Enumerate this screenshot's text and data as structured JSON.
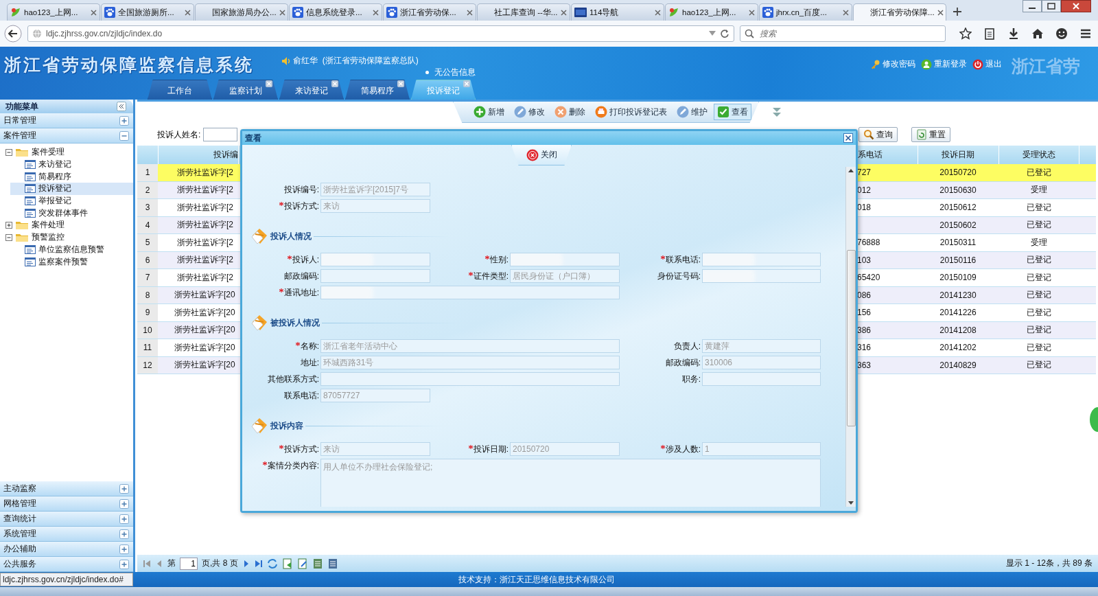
{
  "browser": {
    "tabs": [
      {
        "label": "hao123_上网...",
        "kind": "leaf",
        "selected": false
      },
      {
        "label": "全国旅游厕所...",
        "kind": "paw",
        "selected": false
      },
      {
        "label": "国家旅游局办公...",
        "kind": "blank",
        "selected": false
      },
      {
        "label": "信息系统登录...",
        "kind": "paw",
        "selected": false
      },
      {
        "label": "浙江省劳动保...",
        "kind": "paw",
        "selected": false
      },
      {
        "label": "社工库查询 --华...",
        "kind": "blank",
        "selected": false
      },
      {
        "label": "114导航",
        "kind": "square",
        "selected": false
      },
      {
        "label": "hao123_上网...",
        "kind": "leaf",
        "selected": false
      },
      {
        "label": "jhrx.cn_百度...",
        "kind": "paw",
        "selected": false
      },
      {
        "label": "浙江省劳动保障...",
        "kind": "blank",
        "selected": true
      }
    ],
    "url": "ldjc.zjhrss.gov.cn/zjldjc/index.do",
    "search": {
      "placeholder": "搜索"
    }
  },
  "header": {
    "title": "浙江省劳动保障监察信息系统",
    "user": "俞红华  (浙江省劳动保障监察总队)",
    "notice": "无公告信息",
    "ghost_title": "浙江省劳",
    "links": [
      "修改密码",
      "重新登录",
      "退出"
    ],
    "tabs": [
      {
        "label": "工作台",
        "closable": false,
        "selected": false
      },
      {
        "label": "监察计划",
        "closable": true,
        "selected": false
      },
      {
        "label": "来访登记",
        "closable": true,
        "selected": false
      },
      {
        "label": "简易程序",
        "closable": true,
        "selected": false
      },
      {
        "label": "投诉登记",
        "closable": true,
        "selected": true
      }
    ]
  },
  "sidebar": {
    "title": "功能菜单",
    "groups": [
      {
        "label": "日常管理",
        "expanded": false
      },
      {
        "label": "案件管理",
        "expanded": true,
        "children": [
          {
            "label": "案件受理",
            "expanded": true,
            "children": [
              {
                "label": "来访登记",
                "selected": false
              },
              {
                "label": "简易程序",
                "selected": false
              },
              {
                "label": "投诉登记",
                "selected": true
              },
              {
                "label": "举报登记",
                "selected": false
              },
              {
                "label": "突发群体事件",
                "selected": false
              }
            ]
          },
          {
            "label": "案件处理",
            "expanded": false
          },
          {
            "label": "预警监控",
            "expanded": true,
            "children": [
              {
                "label": "单位监察信息预警",
                "selected": false
              },
              {
                "label": "监察案件预警",
                "selected": false
              }
            ]
          }
        ]
      },
      {
        "label": "主动监察",
        "expanded": false
      },
      {
        "label": "网格管理",
        "expanded": false
      },
      {
        "label": "查询统计",
        "expanded": false
      },
      {
        "label": "系统管理",
        "expanded": false
      },
      {
        "label": "办公辅助",
        "expanded": false
      },
      {
        "label": "公共服务",
        "expanded": false
      }
    ]
  },
  "toolbar": {
    "actions": [
      {
        "label": "新增",
        "selected": false
      },
      {
        "label": "修改",
        "selected": false
      },
      {
        "label": "删除",
        "selected": false
      },
      {
        "label": "打印投诉登记表",
        "selected": false
      },
      {
        "label": "维护",
        "selected": false
      },
      {
        "label": "查看",
        "selected": true
      }
    ]
  },
  "search": {
    "label": "投诉人姓名:",
    "buttons": [
      "查询",
      "重置"
    ]
  },
  "table": {
    "columns": [
      "投诉编",
      "系电话",
      "投诉日期",
      "受理状态"
    ],
    "rows": [
      {
        "number": "1",
        "id": "浙劳社监诉字[2",
        "phone": "727",
        "date": "20150720",
        "status": "已登记",
        "selected": true
      },
      {
        "number": "2",
        "id": "浙劳社监诉字[2",
        "phone": "012",
        "date": "20150630",
        "status": "受理",
        "selected": false
      },
      {
        "number": "3",
        "id": "浙劳社监诉字[2",
        "phone": "018",
        "date": "20150612",
        "status": "已登记",
        "selected": false
      },
      {
        "number": "4",
        "id": "浙劳社监诉字[2",
        "date": "20150602",
        "status": "已登记",
        "selected": false
      },
      {
        "number": "5",
        "id": "浙劳社监诉字[2",
        "phone": "76888",
        "date": "20150311",
        "status": "受理",
        "selected": false
      },
      {
        "number": "6",
        "id": "浙劳社监诉字[2",
        "phone": "103",
        "date": "20150116",
        "status": "已登记",
        "selected": false
      },
      {
        "number": "7",
        "id": "浙劳社监诉字[2",
        "phone": "65420",
        "date": "20150109",
        "status": "已登记",
        "selected": false
      },
      {
        "number": "8",
        "id": "浙劳社监诉字[20",
        "phone": "086",
        "date": "20141230",
        "status": "已登记",
        "selected": false
      },
      {
        "number": "9",
        "id": "浙劳社监诉字[20",
        "phone": "156",
        "date": "20141226",
        "status": "已登记",
        "selected": false
      },
      {
        "number": "10",
        "id": "浙劳社监诉字[20",
        "phone": "386",
        "date": "20141208",
        "status": "已登记",
        "selected": false
      },
      {
        "number": "11",
        "id": "浙劳社监诉字[20",
        "phone": "316",
        "date": "20141202",
        "status": "已登记",
        "selected": false
      },
      {
        "number": "12",
        "id": "浙劳社监诉字[20",
        "phone": "363",
        "date": "20140829",
        "status": "已登记",
        "selected": false
      }
    ]
  },
  "pager": {
    "before": "第",
    "page": "1",
    "after": "页,共 8 页",
    "info": "显示 1 - 12条，共 89 条"
  },
  "dialog": {
    "title": "查看",
    "close_label": "关闭",
    "sections": [
      {
        "rows": [
          {
            "fields": [
              {
                "label": "投诉编号:",
                "required": false,
                "value": "浙劳社监诉字[2015]7号"
              }
            ]
          },
          {
            "fields": [
              {
                "label": "投诉方式:",
                "required": true,
                "value": "来访"
              }
            ]
          }
        ]
      },
      {
        "title": "投诉人情况",
        "rows": [
          {
            "fields": [
              {
                "label": "投诉人:",
                "required": true,
                "blurred": true
              },
              {
                "label": "性别:",
                "required": true,
                "blurred": true
              },
              {
                "label": "联系电话:",
                "required": true,
                "blurred": true
              }
            ]
          },
          {
            "fields": [
              {
                "label": "邮政编码:",
                "required": false
              },
              {
                "label": "证件类型:",
                "required": true,
                "value": "居民身份证（户口簿）"
              },
              {
                "label": "身份证号码:",
                "required": false,
                "blurred": true
              }
            ]
          },
          {
            "fields": [
              {
                "label": "通讯地址:",
                "required": true,
                "blurred": true,
                "wide": true
              }
            ]
          }
        ]
      },
      {
        "title": "被投诉人情况",
        "rows": [
          {
            "fields": [
              {
                "label": "名称:",
                "required": true,
                "value": "浙江省老年活动中心",
                "wide": true
              },
              {
                "label": "负责人:",
                "required": false,
                "value": "黄建萍"
              }
            ]
          },
          {
            "fields": [
              {
                "label": "地址:",
                "required": false,
                "value": "环城西路31号",
                "wide": true
              },
              {
                "label": "邮政编码:",
                "required": false,
                "value": "310006"
              }
            ]
          },
          {
            "fields": [
              {
                "label": "其他联系方式:",
                "required": false,
                "wide": true
              },
              {
                "label": "职务:",
                "required": false
              }
            ]
          },
          {
            "fields": [
              {
                "label": "联系电话:",
                "required": false,
                "value": "87057727"
              }
            ]
          }
        ]
      },
      {
        "title": "投诉内容",
        "rows": [
          {
            "fields": [
              {
                "label": "投诉方式:",
                "required": true,
                "value": "来访"
              },
              {
                "label": "投诉日期:",
                "required": true,
                "value": "20150720"
              },
              {
                "label": "涉及人数:",
                "required": true,
                "value": "1"
              }
            ]
          },
          {
            "fields": [
              {
                "label": "案情分类内容:",
                "required": true,
                "value": "用人单位不办理社会保险登记;",
                "kind": "textarea"
              }
            ]
          }
        ]
      }
    ]
  },
  "status_url": "ldjc.zjhrss.gov.cn/zjldjc/index.do#",
  "footer": "技术支持：浙江天正思维信息技术有限公司"
}
